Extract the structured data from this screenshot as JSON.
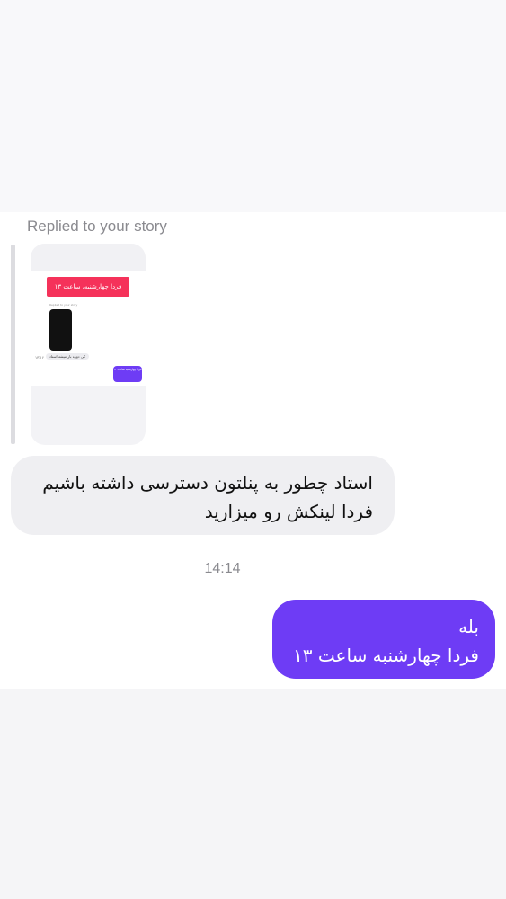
{
  "conversation": {
    "replied_label": "Replied to your story",
    "story_preview": {
      "banner_text": "فردا چهارشنبه، ساعت ۱۳",
      "replied_label": "Replied to your story",
      "incoming_text": "کی دوره بار میشه استاد",
      "time_text": "۱۳:۱۶",
      "outgoing_text": "فردا چهارشنبه ساعت ۱۳"
    },
    "incoming_message": {
      "lines": [
        "استاد چطور به پنلتون دسترسی داشته باشیم",
        "فردا لینکش رو میزارید"
      ]
    },
    "timestamp": "14:14",
    "outgoing_message": {
      "lines": [
        "بله",
        "فردا چهارشنبه ساعت ۱۳"
      ]
    }
  },
  "colors": {
    "outgoing_bubble": "#6e3cf5",
    "incoming_bubble": "#efeff2",
    "story_banner": "#f5325a"
  }
}
